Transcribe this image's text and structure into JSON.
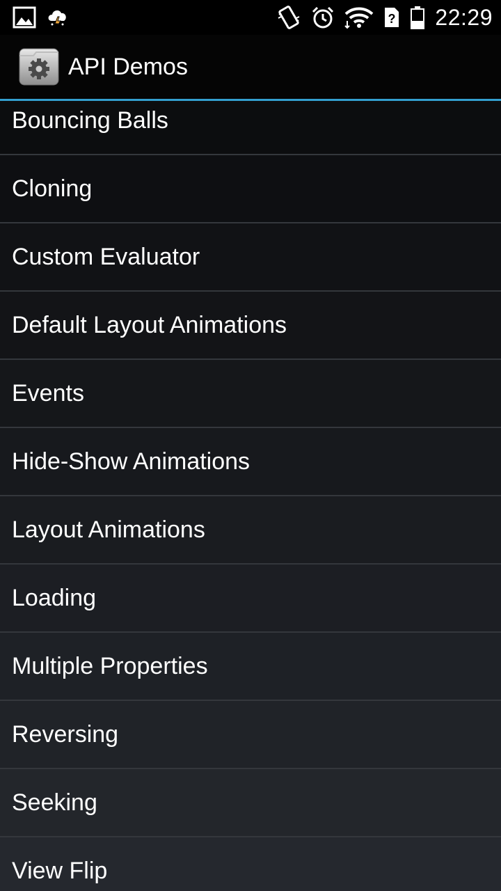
{
  "status_bar": {
    "time": "22:29",
    "left_icons": [
      "gallery-icon",
      "weather-storm-icon"
    ],
    "right_icons": [
      "vibrate-icon",
      "alarm-icon",
      "wifi-icon",
      "no-sim-icon",
      "battery-icon"
    ]
  },
  "action_bar": {
    "app_icon": "settings-folder-icon",
    "title": "API Demos",
    "accent_color": "#33a0d0"
  },
  "list": {
    "items": [
      {
        "label": "Bouncing Balls"
      },
      {
        "label": "Cloning"
      },
      {
        "label": "Custom Evaluator"
      },
      {
        "label": "Default Layout Animations"
      },
      {
        "label": "Events"
      },
      {
        "label": "Hide-Show Animations"
      },
      {
        "label": "Layout Animations"
      },
      {
        "label": "Loading"
      },
      {
        "label": "Multiple Properties"
      },
      {
        "label": "Reversing"
      },
      {
        "label": "Seeking"
      },
      {
        "label": "View Flip"
      }
    ]
  }
}
